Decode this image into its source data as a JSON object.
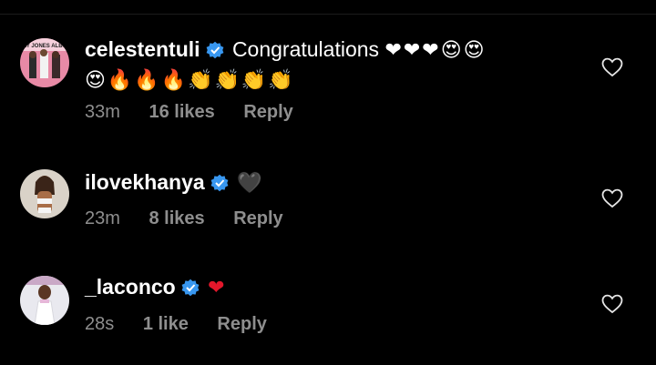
{
  "comments": [
    {
      "username": "celestentuli",
      "avatar_text": "AY JONES ALBU",
      "text": "Congratulations",
      "emoji_line1": "❤❤❤😍😍",
      "emoji_line2": "😍🔥🔥🔥👏👏👏👏",
      "time": "33m",
      "likes": "16 likes",
      "reply": "Reply"
    },
    {
      "username": "ilovekhanya",
      "emoji_line1": "🖤",
      "time": "23m",
      "likes": "8 likes",
      "reply": "Reply"
    },
    {
      "username": "_laconco",
      "emoji_line1": "❤",
      "time": "28s",
      "likes": "1 like",
      "reply": "Reply"
    }
  ],
  "colors": {
    "background": "#000000",
    "meta_text": "#8e8e8e",
    "verified": "#3897f0",
    "heart_red": "#e3172b"
  },
  "icons": {
    "verified": "verified-badge-icon",
    "like": "heart-outline-icon"
  }
}
